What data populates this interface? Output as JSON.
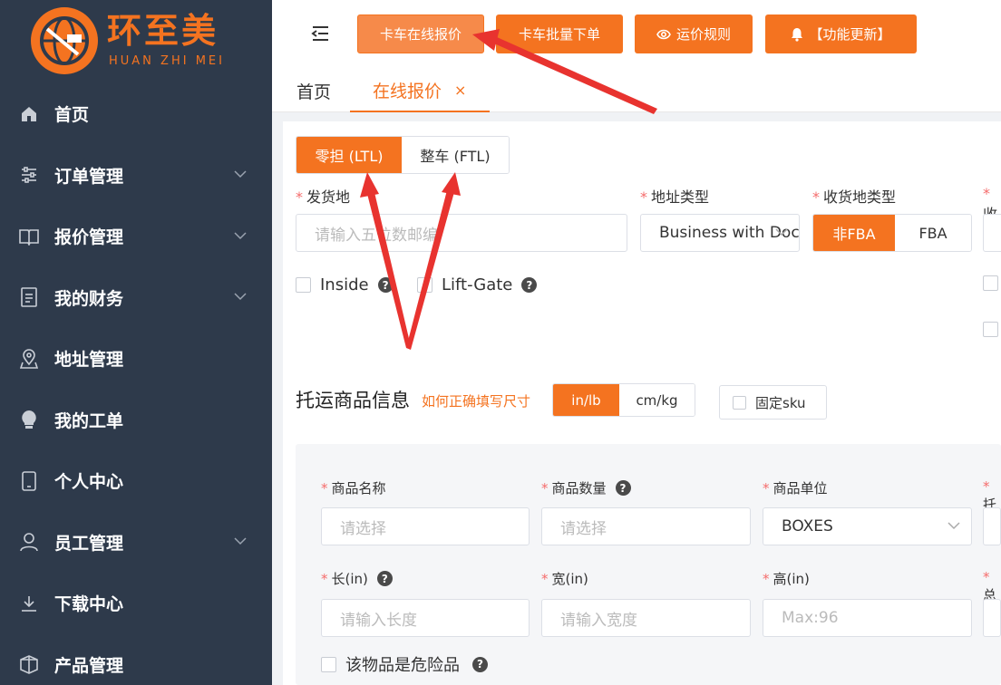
{
  "brand": {
    "name": "环至美",
    "subtitle": "HUAN ZHI MEI",
    "color": "#f47320"
  },
  "sidebar": {
    "items": [
      {
        "label": "首页",
        "icon": "home-icon",
        "expandable": false
      },
      {
        "label": "订单管理",
        "icon": "sliders-icon",
        "expandable": true
      },
      {
        "label": "报价管理",
        "icon": "book-icon",
        "expandable": true
      },
      {
        "label": "我的财务",
        "icon": "document-icon",
        "expandable": true
      },
      {
        "label": "地址管理",
        "icon": "location-pin-icon",
        "expandable": false
      },
      {
        "label": "我的工单",
        "icon": "lightbulb-icon",
        "expandable": false
      },
      {
        "label": "个人中心",
        "icon": "tablet-icon",
        "expandable": false
      },
      {
        "label": "员工管理",
        "icon": "user-icon",
        "expandable": true
      },
      {
        "label": "下载中心",
        "icon": "download-icon",
        "expandable": false
      },
      {
        "label": "产品管理",
        "icon": "box-icon",
        "expandable": false
      }
    ]
  },
  "toolbar": {
    "btn_online_quote": "卡车在线报价",
    "btn_batch_order": "卡车批量下单",
    "btn_rules": "运价规则",
    "btn_updates": "【功能更新】"
  },
  "tabs": {
    "home": "首页",
    "active": "在线报价",
    "close": "×"
  },
  "mode": {
    "ltl": "零担 (LTL)",
    "ftl": "整车 (FTL)",
    "selected": "ltl"
  },
  "form": {
    "origin_label": "发货地",
    "origin_placeholder": "请输入五位数邮编",
    "address_type_label": "地址类型",
    "address_type_value": "Business with Dock",
    "dest_type_label": "收货地类型",
    "dest_type_options": [
      "非FBA",
      "FBA"
    ],
    "dest_type_selected": "非FBA",
    "fourth_label": "收",
    "inside_label": "Inside",
    "liftgate_label": "Lift-Gate"
  },
  "cargo": {
    "title": "托运商品信息",
    "size_help_link": "如何正确填写尺寸",
    "units": [
      "in/lb",
      "cm/kg"
    ],
    "unit_selected": "in/lb",
    "fixed_sku_label": "固定sku",
    "name_label": "商品名称",
    "name_placeholder": "请选择",
    "qty_label": "商品数量",
    "qty_placeholder": "请选择",
    "unit_label": "商品单位",
    "unit_value": "BOXES",
    "fourth_label": "托",
    "length_label": "长(in)",
    "length_placeholder": "请输入长度",
    "width_label": "宽(in)",
    "width_placeholder": "请输入宽度",
    "height_label": "高(in)",
    "height_placeholder": "Max:96",
    "weight_label": "总",
    "dangerous_label": "该物品是危险品"
  },
  "colors": {
    "accent": "#f47320",
    "sidebar_bg": "#2e3a4b",
    "annotation": "#e8332f"
  }
}
